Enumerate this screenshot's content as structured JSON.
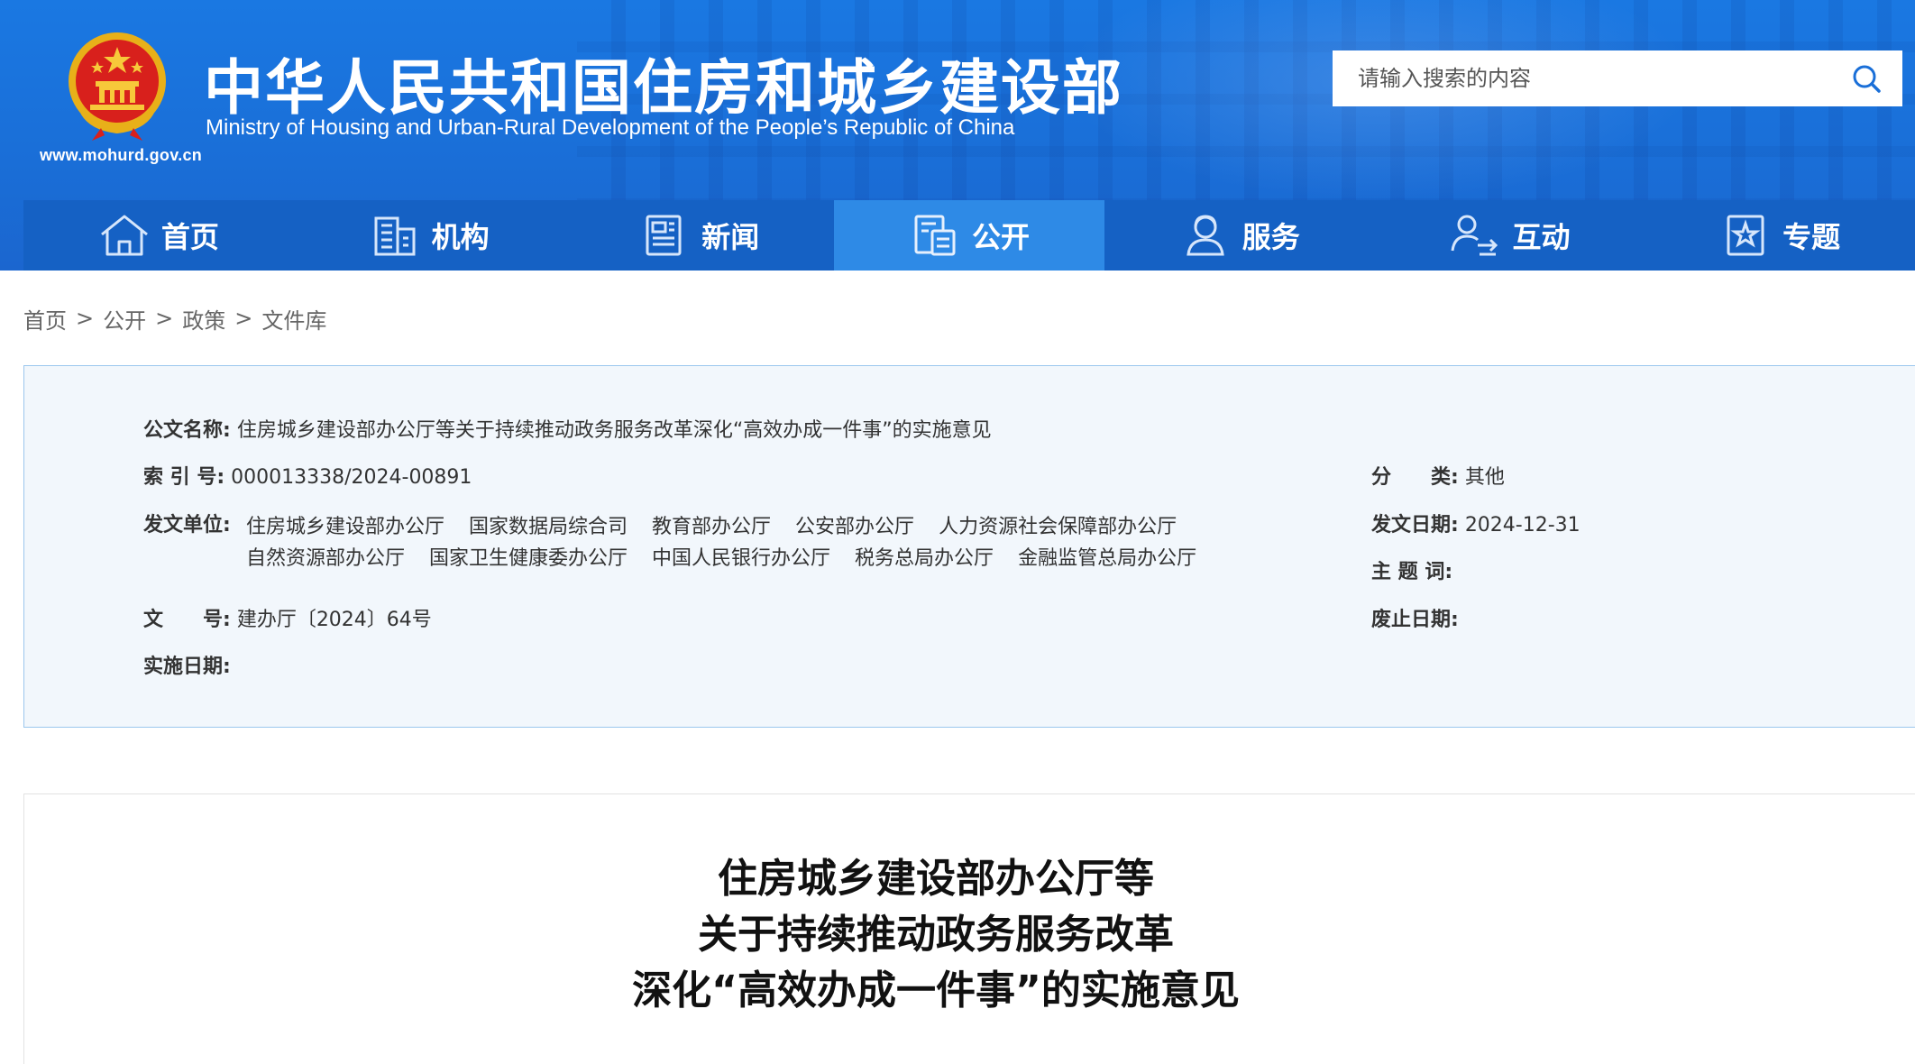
{
  "header": {
    "site_url": "www.mohurd.gov.cn",
    "title_cn": "中华人民共和国住房和城乡建设部",
    "title_en": "Ministry of Housing and Urban-Rural Development of the People’s Republic of China",
    "search_placeholder": "请输入搜索的内容",
    "search_icon": "search-icon"
  },
  "nav": {
    "items": [
      {
        "label": "首页",
        "icon": "home-icon"
      },
      {
        "label": "机构",
        "icon": "building-icon"
      },
      {
        "label": "新闻",
        "icon": "newspaper-icon"
      },
      {
        "label": "公开",
        "icon": "document-icon"
      },
      {
        "label": "服务",
        "icon": "service-icon"
      },
      {
        "label": "互动",
        "icon": "interaction-icon"
      },
      {
        "label": "专题",
        "icon": "star-icon"
      }
    ],
    "active_index": 3
  },
  "breadcrumb": {
    "items": [
      "首页",
      "公开",
      "政策",
      "文件库"
    ],
    "separator": ">"
  },
  "info": {
    "doc_name_label": "公文名称:",
    "doc_name": "住房城乡建设部办公厅等关于持续推动政务服务改革深化“高效办成一件事”的实施意见",
    "index_label": "索 引 号:",
    "index": "000013338/2024-00891",
    "category_label": "分　　类:",
    "category": "其他",
    "issuer_label": "发文单位:",
    "issuers": [
      "住房城乡建设部办公厅",
      "国家数据局综合司",
      "教育部办公厅",
      "公安部办公厅",
      "人力资源社会保障部办公厅",
      "自然资源部办公厅",
      "国家卫生健康委办公厅",
      "中国人民银行办公厅",
      "税务总局办公厅",
      "金融监管总局办公厅"
    ],
    "date_label": "发文日期:",
    "date": "2024-12-31",
    "keywords_label": "主 题 词:",
    "keywords": "",
    "doc_no_label": "文　　号:",
    "doc_no": "建办厅〔2024〕64号",
    "abolish_label": "废止日期:",
    "abolish": "",
    "effective_label": "实施日期:",
    "effective": ""
  },
  "content": {
    "title_lines": [
      "住房城乡建设部办公厅等",
      "关于持续推动政务服务改革",
      "深化“高效办成一件事”的实施意见"
    ]
  },
  "colors": {
    "header_blue": "#1a72dc",
    "nav_blue": "#1561c4",
    "nav_active": "#2e8ae6",
    "info_bg": "#f2f7fc",
    "info_border": "#9cc7ee"
  }
}
